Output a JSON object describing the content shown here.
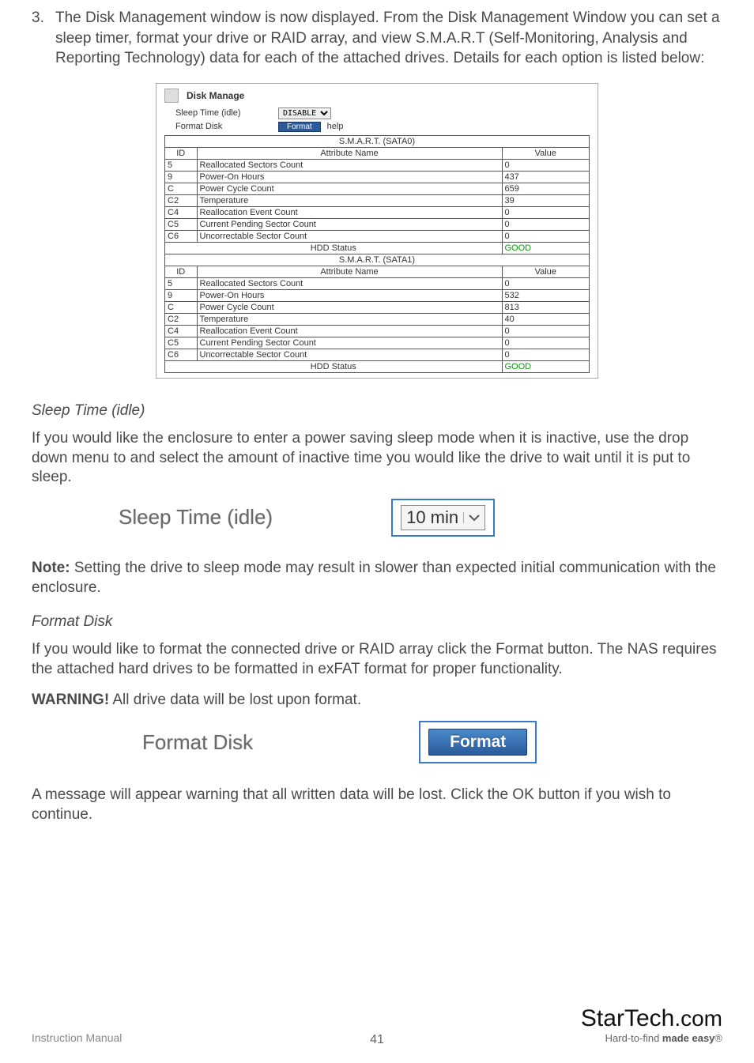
{
  "step": {
    "number": "3.",
    "text": "The Disk Management window is now displayed.  From the Disk Management Window you can set a sleep timer, format your drive or RAID array, and view S.M.A.R.T (Self-Monitoring, Analysis and Reporting Technology) data for each of the attached drives.  Details for each option is listed below:"
  },
  "disk_manage": {
    "title": "Disk Manage",
    "sleep_label": "Sleep Time (idle)",
    "sleep_value": "DISABLE",
    "format_label": "Format Disk",
    "format_button": "Format",
    "help": "help",
    "sata0": {
      "header": "S.M.A.R.T. (SATA0)",
      "col_id": "ID",
      "col_attr": "Attribute Name",
      "col_val": "Value",
      "rows": [
        {
          "id": "5",
          "attr": "Reallocated Sectors Count",
          "val": "0"
        },
        {
          "id": "9",
          "attr": "Power-On Hours",
          "val": "437"
        },
        {
          "id": "C",
          "attr": "Power Cycle Count",
          "val": "659"
        },
        {
          "id": "C2",
          "attr": "Temperature",
          "val": "39"
        },
        {
          "id": "C4",
          "attr": "Reallocation Event Count",
          "val": "0"
        },
        {
          "id": "C5",
          "attr": "Current Pending Sector Count",
          "val": "0"
        },
        {
          "id": "C6",
          "attr": "Uncorrectable Sector Count",
          "val": "0"
        }
      ],
      "status_label": "HDD Status",
      "status_value": "GOOD"
    },
    "sata1": {
      "header": "S.M.A.R.T. (SATA1)",
      "col_id": "ID",
      "col_attr": "Attribute Name",
      "col_val": "Value",
      "rows": [
        {
          "id": "5",
          "attr": "Reallocated Sectors Count",
          "val": "0"
        },
        {
          "id": "9",
          "attr": "Power-On Hours",
          "val": "532"
        },
        {
          "id": "C",
          "attr": "Power Cycle Count",
          "val": "813"
        },
        {
          "id": "C2",
          "attr": "Temperature",
          "val": "40"
        },
        {
          "id": "C4",
          "attr": "Reallocation Event Count",
          "val": "0"
        },
        {
          "id": "C5",
          "attr": "Current Pending Sector Count",
          "val": "0"
        },
        {
          "id": "C6",
          "attr": "Uncorrectable Sector Count",
          "val": "0"
        }
      ],
      "status_label": "HDD Status",
      "status_value": "GOOD"
    }
  },
  "sleep_section": {
    "heading": "Sleep Time (idle)",
    "body": "If you would like the enclosure to enter a power saving sleep mode when it is inactive, use the drop down menu to and select the amount  of inactive time you would like the drive  to wait until it is put to sleep.",
    "inset_label": "Sleep Time (idle)",
    "inset_value": "10 min"
  },
  "note": {
    "prefix": "Note:",
    "text": " Setting the drive to sleep mode may result in slower than expected initial communication with the enclosure."
  },
  "format_section": {
    "heading": "Format Disk",
    "body": "If you would like to format the connected drive or RAID array click the Format button. The NAS requires the attached hard drives to be formatted in exFAT format for proper functionality.",
    "warning_prefix": "WARNING!",
    "warning_text": " All drive data will be lost upon format.",
    "inset_label": "Format Disk",
    "inset_button": "Format",
    "after": "A message will appear warning that all written data will be lost. Click the OK button if you wish to continue."
  },
  "footer": {
    "left": "Instruction Manual",
    "page": "41",
    "logo_main": "StarTech",
    "logo_tail": ".com",
    "logo_sub_a": "Hard-to-find ",
    "logo_sub_b": "made easy",
    "logo_reg": "®"
  }
}
